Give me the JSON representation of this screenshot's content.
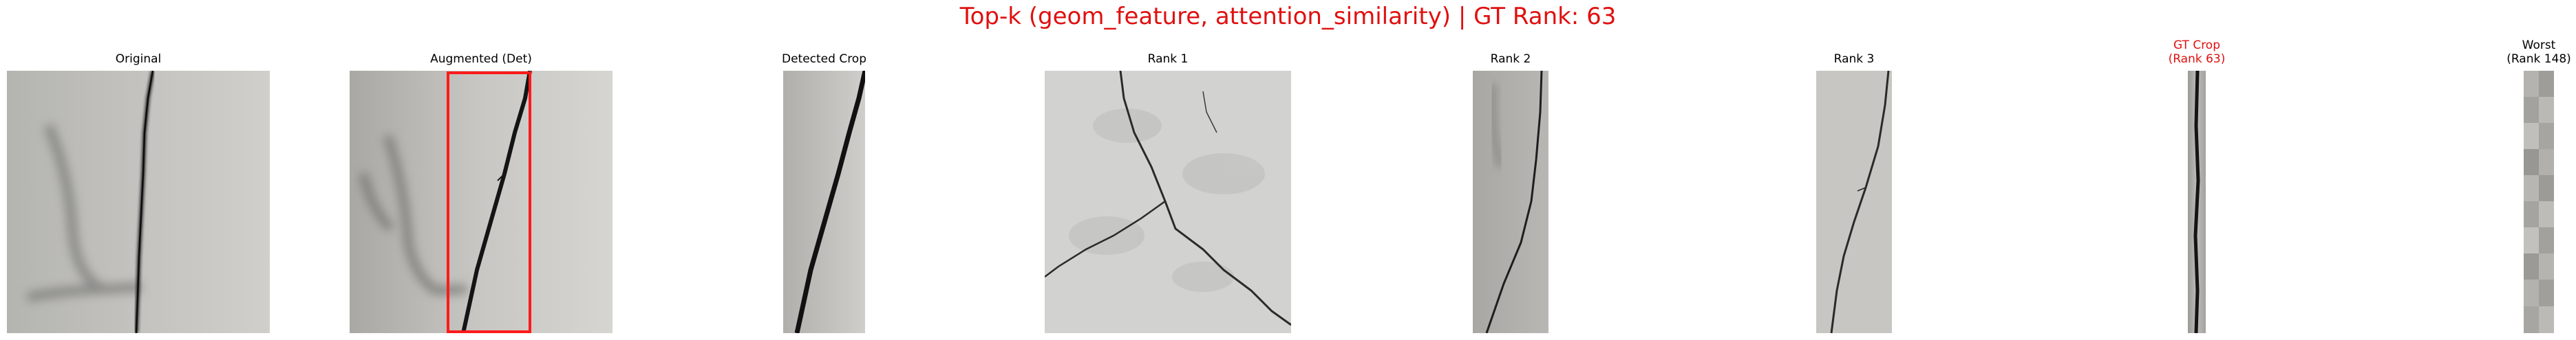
{
  "title": "Top-k (geom_feature, attention_similarity) | GT Rank: 63",
  "colors": {
    "title": "#e01010",
    "gt_label": "#e01010",
    "box": "#ff1a1a"
  },
  "panels": {
    "original": {
      "label": "Original"
    },
    "augmented": {
      "label": "Augmented (Det)"
    },
    "detected": {
      "label": "Detected Crop"
    },
    "rank1": {
      "label": "Rank 1"
    },
    "rank2": {
      "label": "Rank 2"
    },
    "rank3": {
      "label": "Rank 3"
    },
    "gt": {
      "label_line1": "GT Crop",
      "label_line2": "(Rank 63)"
    },
    "worst": {
      "label_line1": "Worst",
      "label_line2": "(Rank 148)"
    }
  }
}
